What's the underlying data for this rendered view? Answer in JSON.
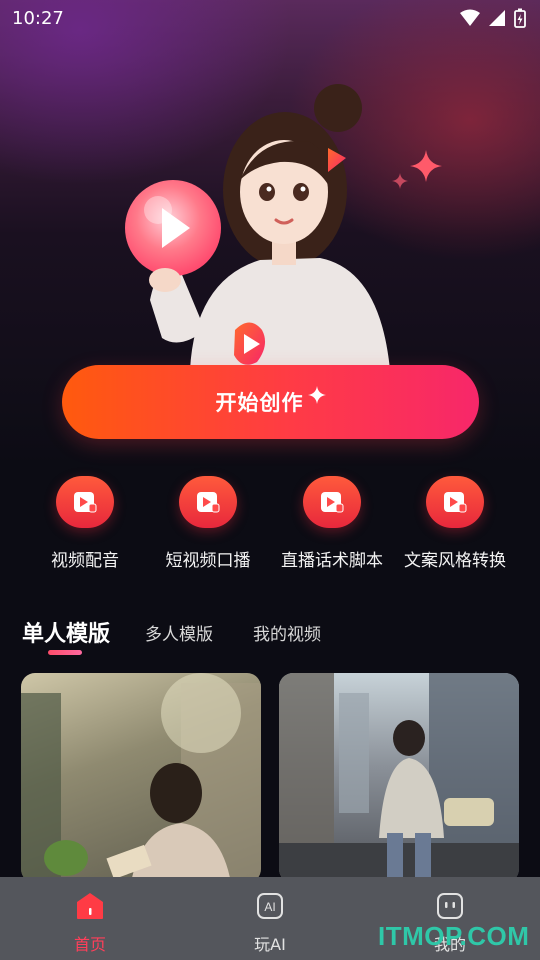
{
  "status_bar": {
    "time": "10:27"
  },
  "hero": {
    "start_button_label": "开始创作"
  },
  "features": [
    {
      "label": "视频配音",
      "icon": "video-voice-icon"
    },
    {
      "label": "短视频口播",
      "icon": "short-video-icon"
    },
    {
      "label": "直播话术脚本",
      "icon": "live-script-icon"
    },
    {
      "label": "文案风格转换",
      "icon": "copy-style-icon"
    }
  ],
  "tabs": [
    {
      "label": "单人模版",
      "active": true
    },
    {
      "label": "多人模版",
      "active": false
    },
    {
      "label": "我的视频",
      "active": false
    }
  ],
  "bottom_nav": [
    {
      "label": "首页",
      "icon": "home-icon",
      "active": true
    },
    {
      "label": "玩AI",
      "icon": "ai-icon",
      "active": false
    },
    {
      "label": "我的",
      "icon": "profile-icon",
      "active": false
    }
  ],
  "watermark": "ITMOP.COM",
  "colors": {
    "accent": "#ff3f5a",
    "button_start": "#ff5a0e",
    "button_end": "#f7276a",
    "nav_bg": "#54565c"
  }
}
